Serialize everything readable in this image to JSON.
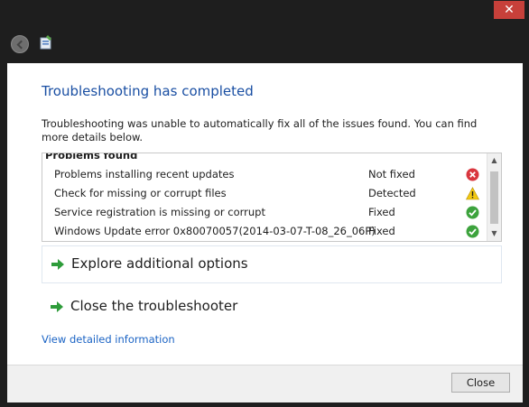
{
  "window": {
    "close_glyph": "✕"
  },
  "header": {
    "back_icon": "back-arrow-icon",
    "app_icon": "troubleshooter-icon"
  },
  "main": {
    "heading": "Troubleshooting has completed",
    "description": "Troubleshooting was unable to automatically fix all of the issues found. You can find more details below.",
    "problems_title": "Problems found",
    "problems": [
      {
        "name": "Problems installing recent updates",
        "status": "Not fixed",
        "icon": "error-icon"
      },
      {
        "name": "Check for missing or corrupt files",
        "status": "Detected",
        "icon": "warning-icon"
      },
      {
        "name": "Service registration is missing or corrupt",
        "status": "Fixed",
        "icon": "check-icon"
      },
      {
        "name": "Windows Update error 0x80070057(2014-03-07-T-08_26_06P)",
        "status": "Fixed",
        "icon": "check-icon"
      }
    ],
    "options": [
      {
        "label": "Explore additional options"
      },
      {
        "label": "Close the troubleshooter"
      }
    ],
    "details_link": "View detailed information"
  },
  "footer": {
    "close_label": "Close"
  },
  "colors": {
    "heading": "#1a4fa3",
    "link": "#1a63c4",
    "error": "#d9363e",
    "warning": "#f2c811",
    "ok": "#3da33d",
    "arrow": "#2e9c3a",
    "window_close": "#c7403a"
  }
}
